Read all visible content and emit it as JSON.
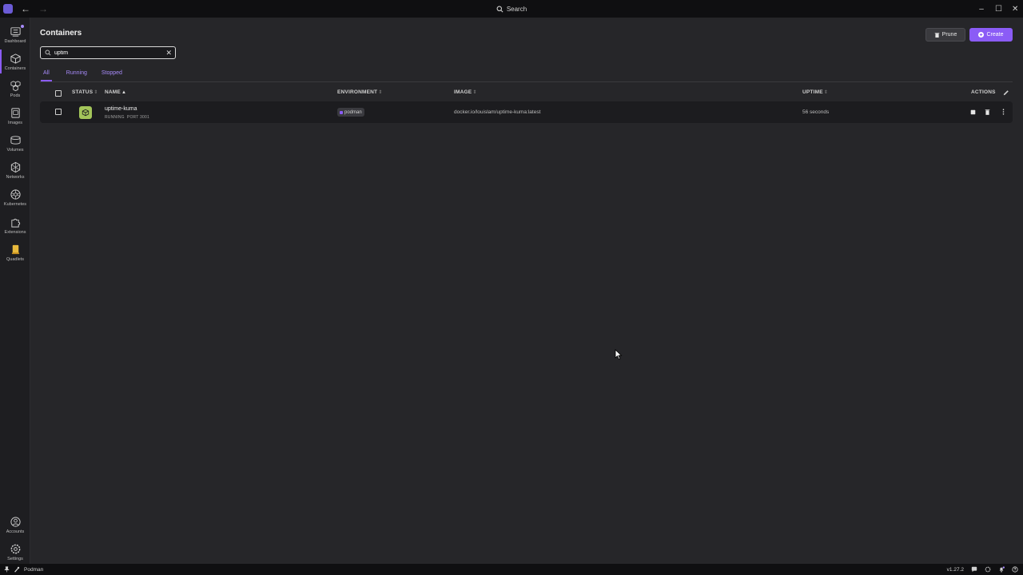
{
  "titlebar": {
    "search_label": "Search"
  },
  "sidebar": {
    "items": [
      {
        "label": "Dashboard",
        "icon": "dashboard-icon"
      },
      {
        "label": "Containers",
        "icon": "container-cube-icon"
      },
      {
        "label": "Pods",
        "icon": "pods-icon"
      },
      {
        "label": "Images",
        "icon": "images-icon"
      },
      {
        "label": "Volumes",
        "icon": "volume-cylinder-icon"
      },
      {
        "label": "Networks",
        "icon": "network-icon"
      },
      {
        "label": "Kubernetes",
        "icon": "kubernetes-wheel-icon"
      },
      {
        "label": "Extensions",
        "icon": "puzzle-icon"
      },
      {
        "label": "Quadlets",
        "icon": "scroll-icon"
      }
    ],
    "bottom_items": [
      {
        "label": "Accounts",
        "icon": "account-icon"
      },
      {
        "label": "Settings",
        "icon": "gear-icon"
      }
    ]
  },
  "page": {
    "title": "Containers",
    "prune_label": "Prune",
    "create_label": "Create"
  },
  "search": {
    "value": "uptim"
  },
  "tabs": [
    {
      "label": "All",
      "active": true
    },
    {
      "label": "Running",
      "active": false
    },
    {
      "label": "Stopped",
      "active": false
    }
  ],
  "table": {
    "headers": {
      "status": "STATUS",
      "name": "NAME",
      "environment": "ENVIRONMENT",
      "image": "IMAGE",
      "uptime": "UPTIME",
      "actions": "ACTIONS"
    },
    "rows": [
      {
        "name": "uptime-kuma",
        "state": "RUNNING",
        "port": "PORT 3001",
        "environment": "podman",
        "image": "docker.io/louislam/uptime-kuma:latest",
        "uptime": "56 seconds"
      }
    ]
  },
  "statusbar": {
    "provider": "Podman",
    "version": "v1.27.2"
  },
  "colors": {
    "accent": "#8b5cf6",
    "running": "#a3c55a",
    "background": "#262629",
    "sidebar": "#1e1e21"
  }
}
